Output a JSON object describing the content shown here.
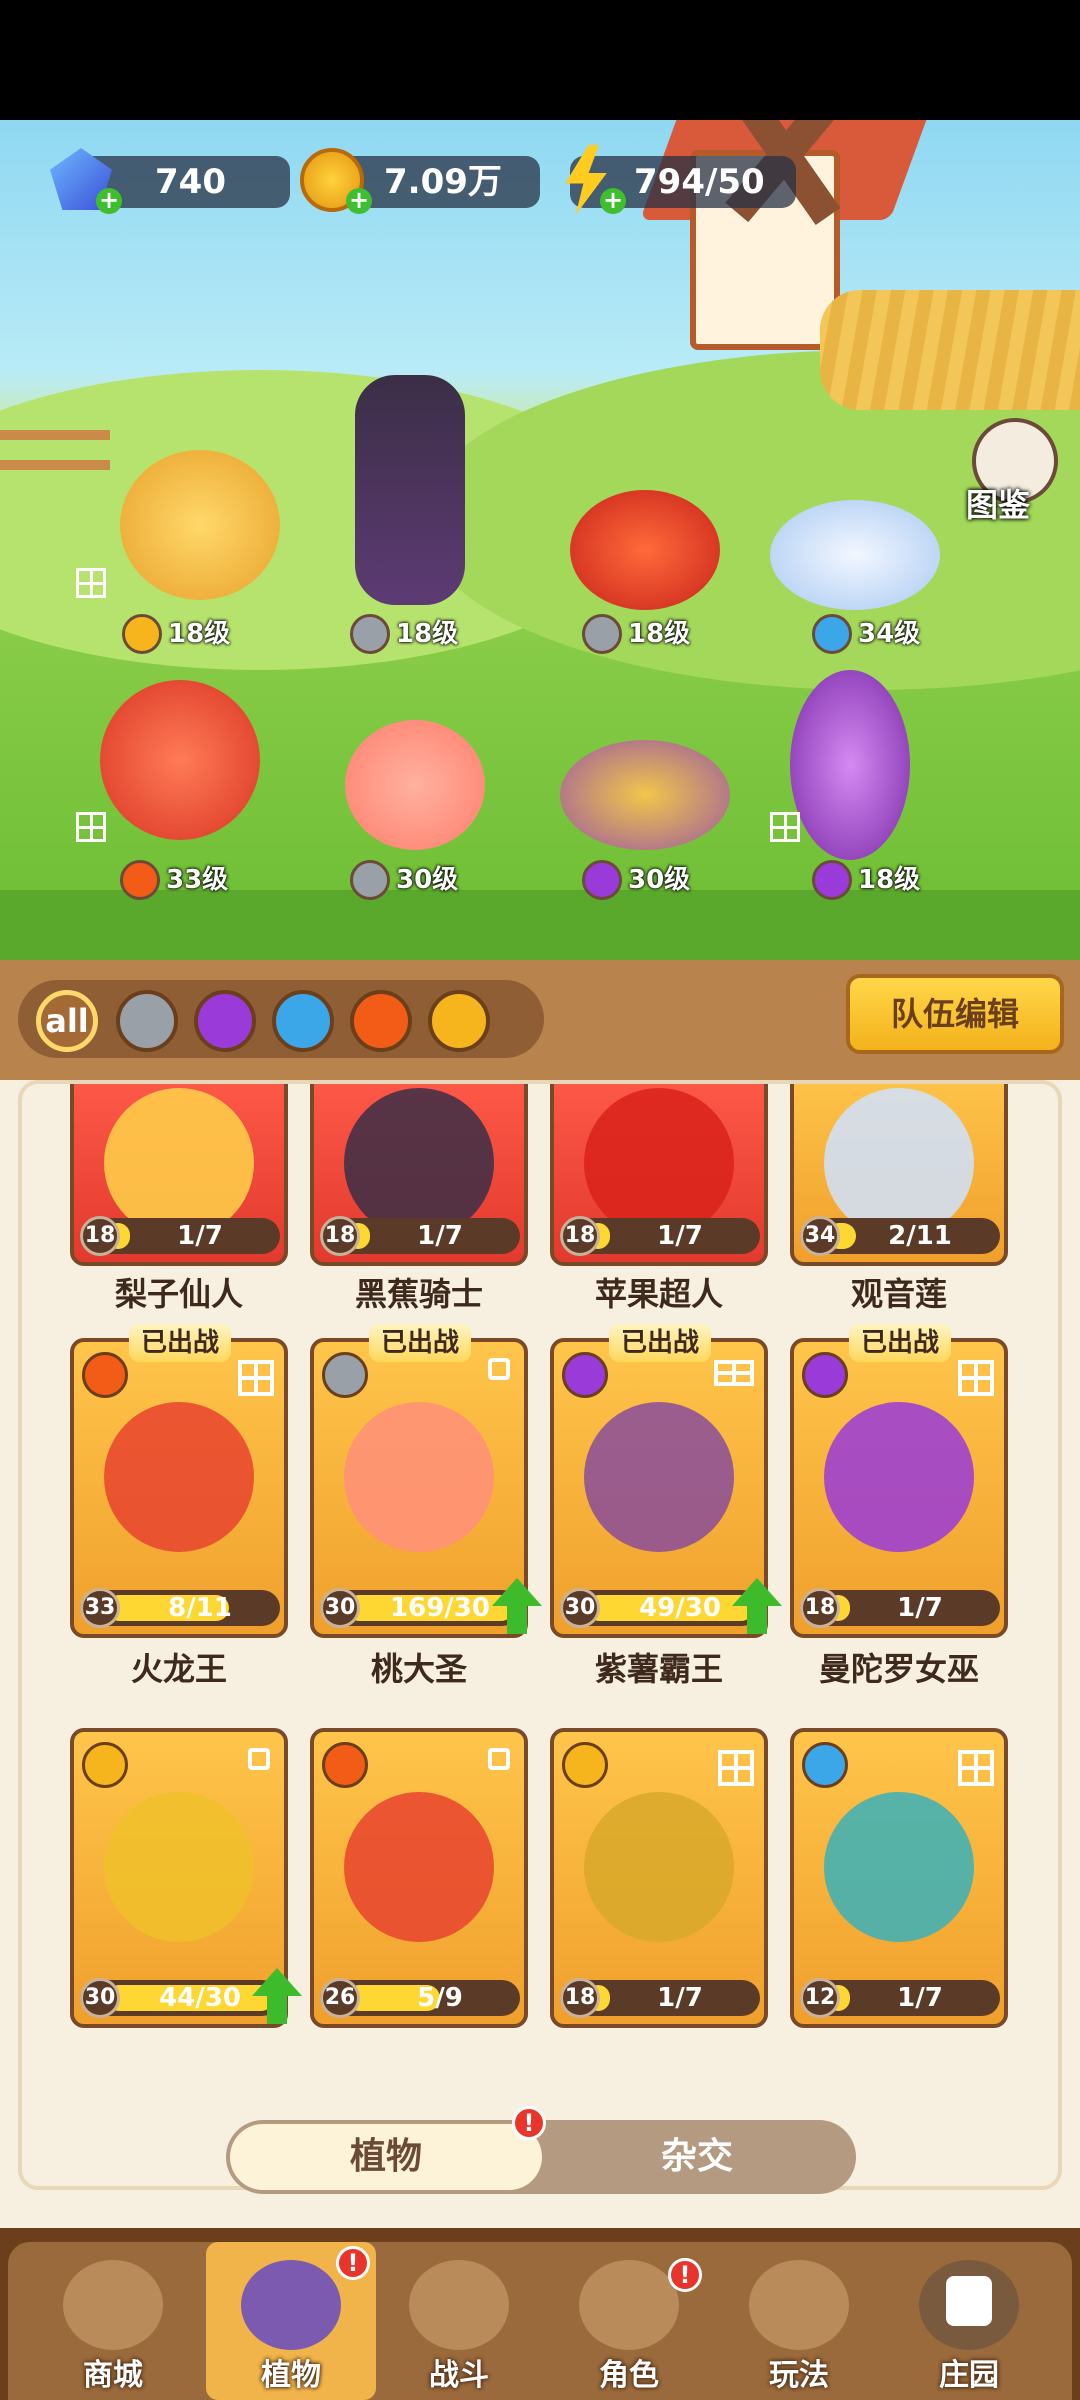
{
  "currencies": {
    "gems": "740",
    "coins": "7.09万",
    "energy": "794/50"
  },
  "codex": {
    "label": "图鉴"
  },
  "scene": {
    "heroes": [
      {
        "element": "thunder",
        "level": "18级"
      },
      {
        "element": "sword",
        "level": "18级"
      },
      {
        "element": "sword",
        "level": "18级"
      },
      {
        "element": "water",
        "level": "34级"
      },
      {
        "element": "fire",
        "level": "33级"
      },
      {
        "element": "sword",
        "level": "30级"
      },
      {
        "element": "poison",
        "level": "30级"
      },
      {
        "element": "poison",
        "level": "18级"
      }
    ]
  },
  "filters": {
    "all_label": "all",
    "items": [
      "sword-icon",
      "poison-icon",
      "water-icon",
      "fire-icon",
      "thunder-icon"
    ]
  },
  "team_edit_label": "队伍编辑",
  "deployed_label": "已出战",
  "cards": [
    {
      "name": "梨子仙人",
      "level": "18",
      "progress": "1/7",
      "fill": 0.14
    },
    {
      "name": "黑蕉骑士",
      "level": "18",
      "progress": "1/7",
      "fill": 0.14
    },
    {
      "name": "苹果超人",
      "level": "18",
      "progress": "1/7",
      "fill": 0.14
    },
    {
      "name": "观音莲",
      "level": "34",
      "progress": "2/11",
      "fill": 0.18
    },
    {
      "name": "火龙王",
      "level": "33",
      "progress": "8/11",
      "fill": 0.73
    },
    {
      "name": "桃大圣",
      "level": "30",
      "progress": "169/30",
      "fill": 1
    },
    {
      "name": "紫薯霸王",
      "level": "30",
      "progress": "49/30",
      "fill": 1
    },
    {
      "name": "曼陀罗女巫",
      "level": "18",
      "progress": "1/7",
      "fill": 0.14
    },
    {
      "name": "",
      "level": "30",
      "progress": "44/30",
      "fill": 1
    },
    {
      "name": "",
      "level": "26",
      "progress": "5/9",
      "fill": 0.56
    },
    {
      "name": "",
      "level": "18",
      "progress": "1/7",
      "fill": 0.14
    },
    {
      "name": "",
      "level": "12",
      "progress": "1/7",
      "fill": 0.14
    }
  ],
  "toggle": {
    "active": "植物",
    "inactive": "杂交",
    "badge": "!"
  },
  "nav": {
    "items": [
      "商城",
      "植物",
      "战斗",
      "角色",
      "玩法",
      "庄园"
    ],
    "badge": "!"
  },
  "colors": {
    "accent": "#f3b21a",
    "panel": "#f7efe0",
    "brown": "#6b3e1c"
  }
}
